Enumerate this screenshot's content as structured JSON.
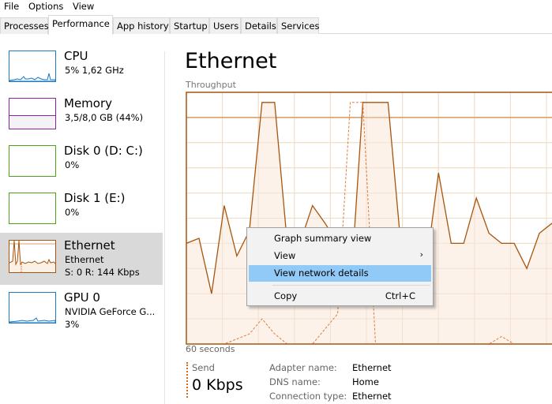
{
  "menubar": {
    "items": [
      {
        "label": "File"
      },
      {
        "label": "Options"
      },
      {
        "label": "View"
      }
    ]
  },
  "tabs": [
    {
      "label": "Processes",
      "active": false
    },
    {
      "label": "Performance",
      "active": true
    },
    {
      "label": "App history",
      "active": false
    },
    {
      "label": "Startup",
      "active": false
    },
    {
      "label": "Users",
      "active": false
    },
    {
      "label": "Details",
      "active": false
    },
    {
      "label": "Services",
      "active": false
    }
  ],
  "sidebar": {
    "items": [
      {
        "title": "CPU",
        "line1": "5% 1,62 GHz",
        "line2": "",
        "color": "#1f7bbf",
        "selected": false
      },
      {
        "title": "Memory",
        "line1": "3,5/8,0 GB (44%)",
        "line2": "",
        "color": "#8b22a5",
        "selected": false,
        "usage_fraction": 0.44
      },
      {
        "title": "Disk 0 (D: C:)",
        "line1": "0%",
        "line2": "",
        "color": "#4da118",
        "selected": false
      },
      {
        "title": "Disk 1 (E:)",
        "line1": "0%",
        "line2": "",
        "color": "#4da118",
        "selected": false
      },
      {
        "title": "Ethernet",
        "line1": "Ethernet",
        "line2": "S: 0 R: 144 Kbps",
        "color": "#a7550f",
        "selected": true
      },
      {
        "title": "GPU 0",
        "line1": "NVIDIA GeForce G...",
        "line2": "3%",
        "color": "#1f7bbf",
        "selected": false
      }
    ]
  },
  "main": {
    "title": "Ethernet",
    "graph_label": "Throughput",
    "time_label": "60 seconds",
    "colors": {
      "line": "#a7550f",
      "fill": "#fcf1e7",
      "grid": "#efdcc8",
      "send_line": "#e07a3e"
    },
    "receive_series": [
      40,
      42,
      20,
      55,
      35,
      45,
      96,
      96,
      40,
      40,
      55,
      48,
      40,
      20,
      96,
      96,
      96,
      40,
      38,
      30,
      68,
      40,
      40,
      58,
      44,
      40,
      40,
      30,
      44,
      48
    ],
    "send_series": [
      0,
      0,
      0,
      0,
      2,
      4,
      10,
      4,
      0,
      0,
      0,
      6,
      12,
      96,
      96,
      0,
      0,
      0,
      0,
      0,
      0,
      0,
      0,
      0,
      0,
      3,
      0,
      0,
      0,
      0
    ],
    "send": {
      "label": "Send",
      "value": "0 Kbps"
    },
    "details": [
      {
        "key": "Adapter name:",
        "value": "Ethernet"
      },
      {
        "key": "DNS name:",
        "value": "Home"
      },
      {
        "key": "Connection type:",
        "value": "Ethernet"
      }
    ]
  },
  "context_menu": {
    "items": [
      {
        "label": "Graph summary view",
        "shortcut": "",
        "submenu": false,
        "highlighted": false
      },
      {
        "label": "View",
        "shortcut": "",
        "submenu": true,
        "highlighted": false
      },
      {
        "label": "View network details",
        "shortcut": "",
        "submenu": false,
        "highlighted": true
      },
      {
        "label": "Copy",
        "shortcut": "Ctrl+C",
        "submenu": false,
        "highlighted": false
      }
    ],
    "submenu_arrow": "›"
  }
}
